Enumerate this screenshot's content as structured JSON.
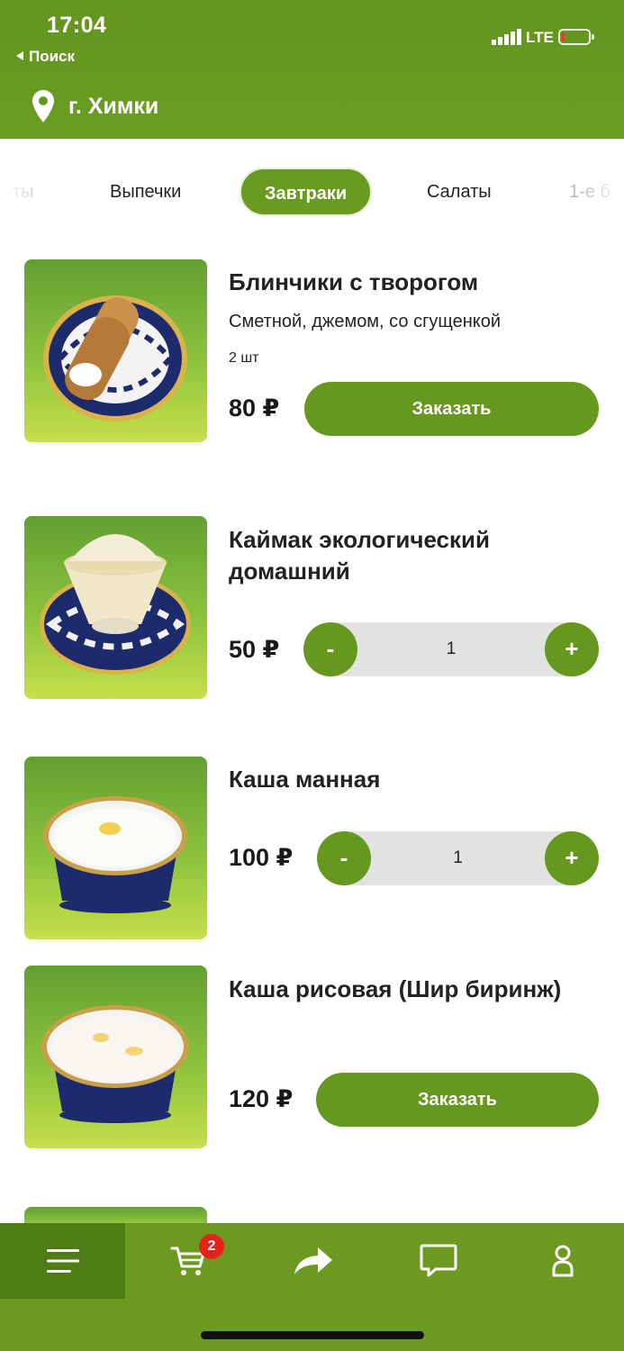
{
  "status_bar": {
    "time": "17:04",
    "back_label": "Поиск",
    "network": "LTE",
    "signal_icon": "signal-bars-icon",
    "battery_icon": "battery-low-icon",
    "battery_level": 0.1,
    "battery_color": "#e53b2c"
  },
  "header": {
    "location_icon": "map-pin-icon",
    "city": "г. Химки",
    "background": "#66991f"
  },
  "tabs": {
    "items": [
      {
        "label": "ты",
        "state": "faded"
      },
      {
        "label": "Выпечки",
        "state": "normal"
      },
      {
        "label": "Завтраки",
        "state": "active"
      },
      {
        "label": "Салаты",
        "state": "normal"
      },
      {
        "label": "1-е б",
        "state": "faded"
      }
    ],
    "active_color": "#6a9a1f"
  },
  "products": [
    {
      "title": "Блинчики с творогом",
      "description": "Сметной, джемом, со сгущенкой",
      "quantity_note": "2 шт",
      "price": "80 ₽",
      "action": "order",
      "order_label": "Заказать",
      "image_icon": "pancakes-plate-image"
    },
    {
      "title": "Каймак экологический домашний",
      "price": "50 ₽",
      "action": "stepper",
      "minus_label": "-",
      "plus_label": "+",
      "count": "1",
      "image_icon": "kaymak-bowl-image"
    },
    {
      "title": "Каша манная",
      "price": "100 ₽",
      "action": "stepper",
      "minus_label": "-",
      "plus_label": "+",
      "count": "1",
      "image_icon": "semolina-bowl-image"
    },
    {
      "title": "Каша рисовая (Шир биринж)",
      "price": "120 ₽",
      "action": "order",
      "order_label": "Заказать",
      "image_icon": "rice-porridge-bowl-image"
    }
  ],
  "bottom_nav": {
    "items": [
      {
        "icon": "menu-icon",
        "active": true
      },
      {
        "icon": "cart-icon",
        "badge": "2"
      },
      {
        "icon": "share-icon"
      },
      {
        "icon": "chat-icon"
      },
      {
        "icon": "profile-icon"
      }
    ],
    "background": "#6c9a21",
    "badge_color": "#e8221b"
  }
}
